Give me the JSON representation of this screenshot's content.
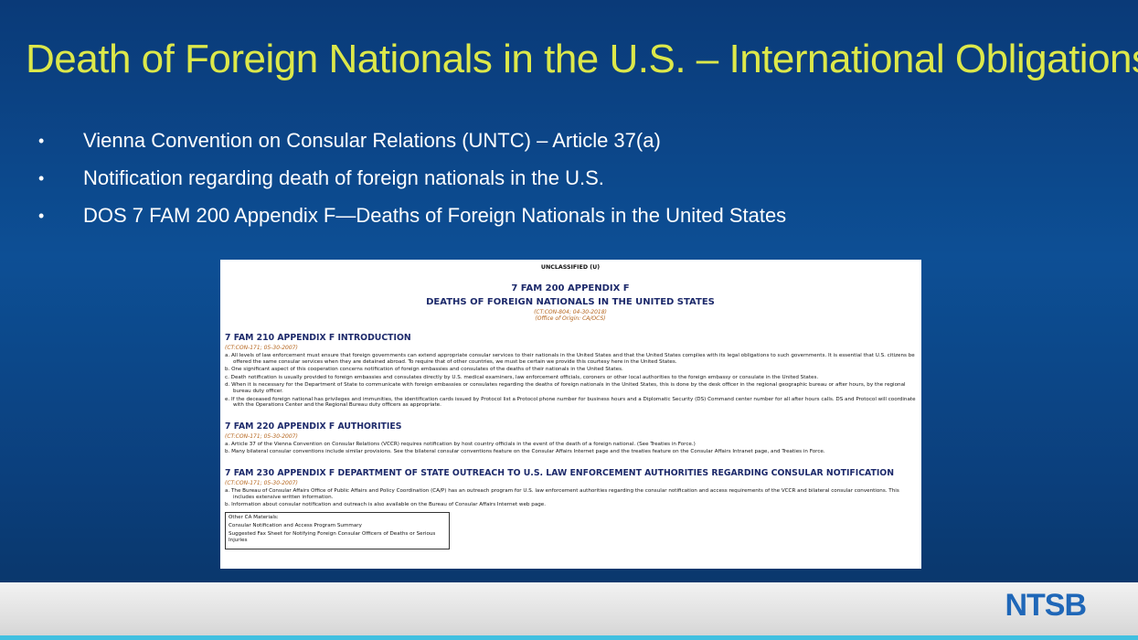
{
  "slide": {
    "title": "Death of Foreign Nationals in the U.S. – International Obligations",
    "bullets": [
      "Vienna Convention on Consular Relations (UNTC) – Article 37(a)",
      "Notification regarding death of foreign nationals in the U.S.",
      "DOS 7 FAM 200 Appendix F—Deaths of Foreign Nationals in the United States"
    ],
    "bullet_char": "•"
  },
  "document": {
    "classification": "UNCLASSIFIED (U)",
    "title_line1": "7 FAM 200 APPENDIX F",
    "title_line2": "DEATHS OF FOREIGN NATIONALS IN THE UNITED STATES",
    "meta_line1": "(CT:CON-804;   04-30-2018)",
    "meta_line2": "(Office of Origin:  CA/OCS)",
    "sections": [
      {
        "heading": "7 FAM 210 APPENDIX F  INTRODUCTION",
        "ct": "(CT:CON-171;   05-30-2007)",
        "paragraphs": [
          "a. All levels of law enforcement must ensure that foreign governments can extend appropriate consular services to their nationals in the United States and that the United States complies with its legal obligations to such governments.  It is essential that U.S. citizens be offered the same consular services when they are detained abroad.  To require that of other countries, we must be certain we provide this courtesy here in the United States.",
          "b. One significant aspect of this cooperation concerns notification of foreign embassies and consulates of the deaths of their nationals in the United States.",
          "c.  Death notification is usually provided to foreign embassies and consulates directly by U.S. medical examiners, law enforcement officials, coroners or other local authorities to the foreign embassy or consulate in the United States.",
          "d. When it is necessary for the Department of State to communicate with foreign embassies or consulates regarding the deaths of foreign nationals in the United States, this is done by the desk officer in the regional geographic bureau or after hours, by the regional bureau duty officer.",
          "e. If the deceased foreign national has privileges and immunities, the identification cards issued by Protocol list a Protocol phone number for business hours and a Diplomatic Security (DS) Command center number for all after hours calls.  DS and Protocol will coordinate with the Operations Center and the Regional Bureau duty officers as appropriate."
        ]
      },
      {
        "heading": "7 FAM 220 APPENDIX F  AUTHORITIES",
        "ct": "(CT:CON-171;   05-30-2007)",
        "paragraphs": [
          "a. Article 37 of the Vienna Convention on Consular Relations (VCCR) requires notification by host country officials in the event of the death of a foreign national.  (See Treaties in Force.)",
          "b. Many bilateral consular conventions include similar provisions.  See the bilateral consular conventions feature on the Consular Affairs Internet page and the treaties feature on the Consular Affairs Intranet page, and Treaties in Force."
        ]
      },
      {
        "heading": "7 FAM 230 APPENDIX F  DEPARTMENT OF STATE OUTREACH TO U.S. LAW ENFORCEMENT AUTHORITIES REGARDING CONSULAR NOTIFICATION",
        "ct": "(CT:CON-171;   05-30-2007)",
        "paragraphs": [
          "a. The Bureau of Consular Affairs Office of Public Affairs and Policy Coordination (CA/P) has an outreach program for U.S. law enforcement authorities regarding the consular notification and access requirements of the VCCR and bilateral consular conventions.  This includes extensive written information.",
          "b. Information about consular notification and outreach is also available on the Bureau of Consular Affairs Internet web page."
        ]
      }
    ],
    "box": [
      "Other CA Materials:",
      "Consular Notification and Access Program Summary",
      "Suggested Fax Sheet for Notifying Foreign Consular Officers of Deaths or Serious Injuries"
    ]
  },
  "footer": {
    "logo": "NTSB"
  },
  "colors": {
    "title": "#dde84a",
    "doc_heading": "#1d2a6b",
    "doc_meta": "#b5651d",
    "logo": "#1f67b8",
    "accent_bar": "#41c0e0"
  }
}
